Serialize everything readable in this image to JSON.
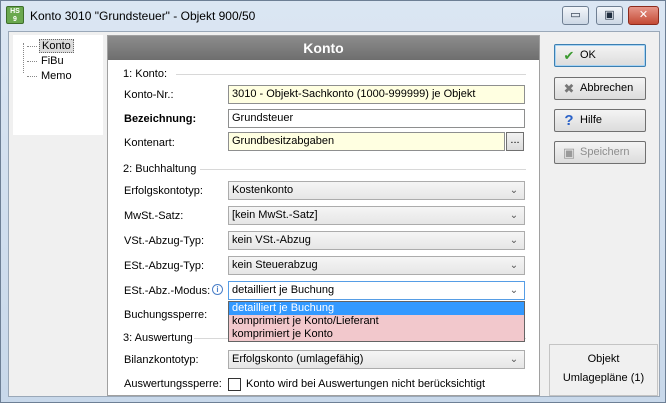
{
  "window": {
    "title": "Konto 3010 \"Grundsteuer\" - Objekt 900/50",
    "icon": "app-logo",
    "controls": {
      "minimize": "▭",
      "maximize": "▣",
      "close": "✕"
    }
  },
  "tree": {
    "items": [
      {
        "label": "Konto",
        "selected": true
      },
      {
        "label": "FiBu",
        "selected": false
      },
      {
        "label": "Memo",
        "selected": false
      }
    ]
  },
  "panel": {
    "title": "Konto",
    "section1": {
      "label": "1: Konto:",
      "fields": {
        "konto_nr": {
          "label": "Konto-Nr.:",
          "value": "3010 - Objekt-Sachkonto (1000-999999) je Objekt"
        },
        "bezeichnung": {
          "label": "Bezeichnung:",
          "value": "Grundsteuer"
        },
        "kontenart": {
          "label": "Kontenart:",
          "value": "Grundbesitzabgaben",
          "button": "..."
        }
      }
    },
    "section2": {
      "label": "2: Buchhaltung",
      "fields": {
        "erfolgskontotyp": {
          "label": "Erfolgskontotyp:",
          "value": "Kostenkonto"
        },
        "mwst_satz": {
          "label": "MwSt.-Satz:",
          "value": "[kein MwSt.-Satz]"
        },
        "vst_abzug_typ": {
          "label": "VSt.-Abzug-Typ:",
          "value": "kein VSt.-Abzug"
        },
        "est_abzug_typ": {
          "label": "ESt.-Abzug-Typ:",
          "value": "kein Steuerabzug"
        },
        "est_abz_modus": {
          "label": "ESt.-Abz.-Modus:",
          "value": "detailliert je Buchung",
          "options": [
            "detailliert je Buchung",
            "komprimiert je Konto/Lieferant",
            "komprimiert je Konto"
          ]
        },
        "buchungssperre": {
          "label": "Buchungssperre:"
        }
      }
    },
    "section3": {
      "label": "3: Auswertung",
      "fields": {
        "bilanzkontotyp": {
          "label": "Bilanzkontotyp:",
          "value": "Erfolgskonto (umlagefähig)"
        },
        "auswertungssperre": {
          "label": "Auswertungssperre:",
          "checkbox_label": "Konto wird bei Auswertungen nicht berücksichtigt",
          "checked": false
        }
      }
    }
  },
  "buttons": {
    "ok": "OK",
    "abbrechen": "Abbrechen",
    "hilfe": "Hilfe",
    "speichern": "Speichern"
  },
  "right_panel": {
    "line1": "Objekt",
    "line2": "Umlagepläne (1)"
  }
}
